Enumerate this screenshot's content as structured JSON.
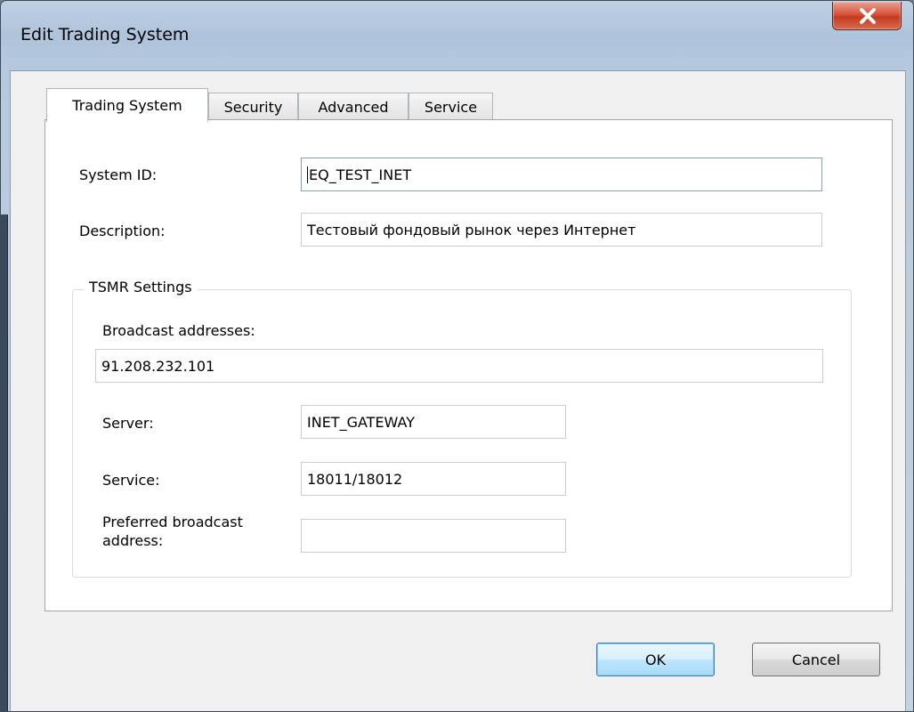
{
  "window": {
    "title": "Edit Trading System"
  },
  "tabs": [
    {
      "label": "Trading System",
      "active": true
    },
    {
      "label": "Security",
      "active": false
    },
    {
      "label": "Advanced",
      "active": false
    },
    {
      "label": "Service",
      "active": false
    }
  ],
  "form": {
    "system_id_label": "System ID:",
    "system_id_value": "EQ_TEST_INET",
    "description_label": "Description:",
    "description_value": "Тестовый фондовый рынок через Интернет"
  },
  "tsmr": {
    "legend": "TSMR Settings",
    "broadcast_label": "Broadcast addresses:",
    "broadcast_value": "91.208.232.101",
    "server_label": "Server:",
    "server_value": "INET_GATEWAY",
    "service_label": "Service:",
    "service_value": "18011/18012",
    "preferred_label": "Preferred broadcast address:",
    "preferred_value": ""
  },
  "buttons": {
    "ok": "OK",
    "cancel": "Cancel"
  },
  "colors": {
    "close_button": "#c43b20",
    "default_button": "#bee6fd",
    "focus_border": "#7ba2cf"
  }
}
